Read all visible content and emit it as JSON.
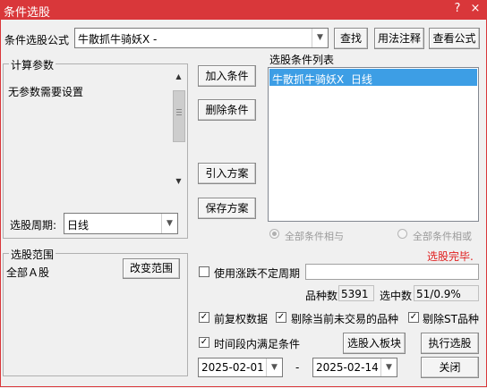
{
  "window": {
    "title": "条件选股",
    "help_symbol": "?",
    "close_symbol": "×"
  },
  "formula_row": {
    "label": "条件选股公式",
    "formula_value": "牛散抓牛骑妖X -",
    "find_button": "查找",
    "usage_button": "用法注释",
    "view_formula_button": "查看公式"
  },
  "params_group": {
    "title": "计算参数",
    "content": "无参数需要设置",
    "period_label": "选股周期:",
    "period_value": "日线"
  },
  "middle_buttons": {
    "add": "加入条件",
    "remove": "删除条件",
    "import": "引入方案",
    "save": "保存方案"
  },
  "condition_list": {
    "title": "选股条件列表",
    "items": [
      "牛散抓牛骑妖X  日线"
    ]
  },
  "logic": {
    "all_and": "全部条件相与",
    "all_or": "全部条件相或"
  },
  "status_text": "选股完毕.",
  "range_group": {
    "title": "选股范围",
    "value": "全部Ａ股",
    "change_button": "改变范围"
  },
  "options": {
    "variable_period_label": "使用涨跌不定周期",
    "variable_period_checked": false,
    "stock_count_label": "品种数",
    "stock_count_value": "5391",
    "selected_label": "选中数",
    "selected_value": "51/0.9%",
    "adjust_label": "前复权数据",
    "adjust_checked": true,
    "exclude_untraded_label": "剔除当前未交易的品种",
    "exclude_untraded_checked": true,
    "exclude_st_label": "剔除ST品种",
    "exclude_st_checked": true,
    "time_range_label": "时间段内满足条件",
    "time_range_checked": true
  },
  "bottom": {
    "to_board_button": "选股入板块",
    "execute_button": "执行选股",
    "start_date": "2025-02-01",
    "date_separator": "-",
    "end_date": "2025-02-14",
    "close_button": "关闭"
  },
  "colors": {
    "titlebar": "#d9373a",
    "selection": "#3d9ee5",
    "status": "#e02020"
  }
}
